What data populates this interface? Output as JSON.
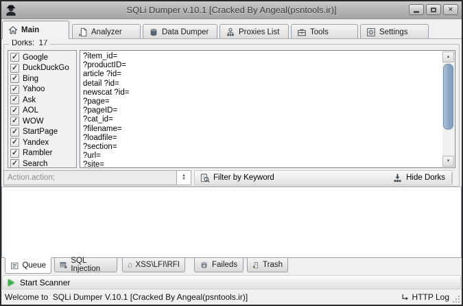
{
  "titlebar": {
    "title": "SQLi Dumper v.10.1 [Cracked By Angeal(psntools.ir)]"
  },
  "icons": {
    "close_glyph": "×",
    "check_glyph": "✓",
    "up_arrow_glyph": "▲",
    "down_arrow_glyph": "▼"
  },
  "tabs_top": [
    {
      "label": "Main",
      "active": true
    },
    {
      "label": "Analyzer",
      "active": false
    },
    {
      "label": "Data Dumper",
      "active": false
    },
    {
      "label": "Proxies List",
      "active": false
    },
    {
      "label": "Tools",
      "active": false
    },
    {
      "label": "Settings",
      "active": false
    }
  ],
  "dorks": {
    "group_label": "Dorks:  17",
    "count": 17,
    "all_checked": true,
    "engines": [
      "Google",
      "DuckDuckGo",
      "Bing",
      "Yahoo",
      "Ask",
      "AOL",
      "WOW",
      "StartPage",
      "Yandex",
      "Rambler",
      "Search"
    ],
    "entries": [
      "?item_id=",
      "?productID=",
      "article ?id=",
      "detail ?id=",
      "newscat ?id=",
      "?page=",
      "?pageID=",
      "?cat_id=",
      "?filename=",
      "?loadfile=",
      "?section=",
      "?url=",
      "?site="
    ]
  },
  "filter_bar": {
    "action_value": "Action.action;",
    "filter_button": "Filter by Keyword",
    "hide_dorks_button": "Hide Dorks"
  },
  "tabs_bottom": [
    {
      "label": "Queue",
      "active": true
    },
    {
      "label": "SQL Injection",
      "active": false
    },
    {
      "label": "XSS\\LFI\\RFI",
      "active": false
    },
    {
      "label": "Faileds",
      "active": false
    },
    {
      "label": "Trash",
      "active": false
    }
  ],
  "scanner_bar": {
    "start_button": "Start Scanner"
  },
  "status_bar": {
    "welcome": "Welcome to  SQLi Dumper V.10.1 [Cracked By Angeal(psntools.ir)]",
    "http_log": "HTTP Log"
  }
}
